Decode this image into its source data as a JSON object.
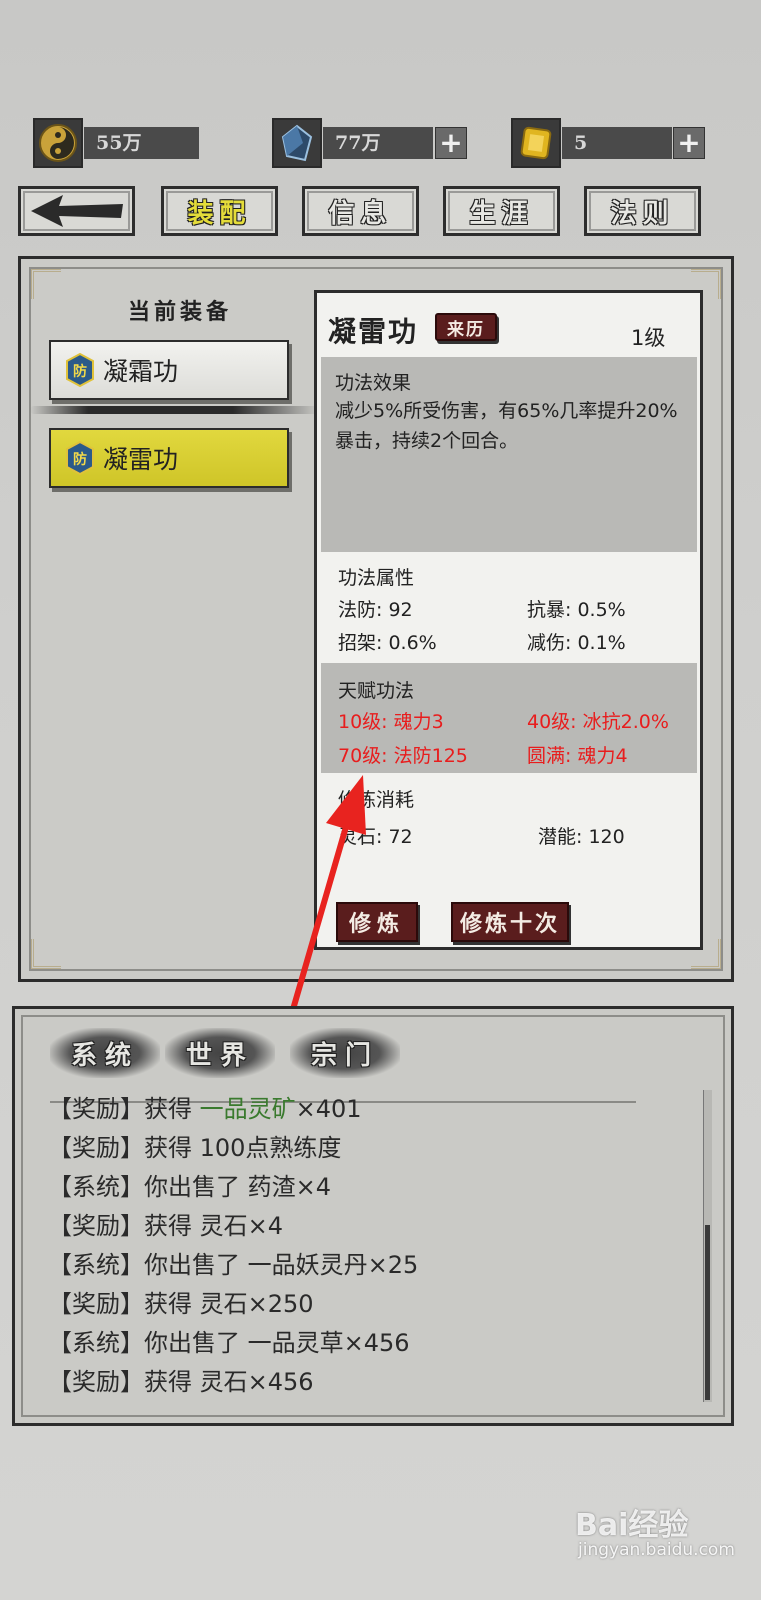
{
  "resources": [
    {
      "icon": "yin-yang-icon",
      "value": "55万",
      "has_plus": false
    },
    {
      "icon": "blue-crystal-icon",
      "value": "77万",
      "has_plus": true
    },
    {
      "icon": "gold-gem-icon",
      "value": "5",
      "has_plus": true
    }
  ],
  "nav": {
    "tabs": [
      "装配",
      "信息",
      "生涯",
      "法则"
    ],
    "active_tab": "装配"
  },
  "equip": {
    "header": "当前装备",
    "items": [
      {
        "label": "凝霜功",
        "badge": "防",
        "selected": false
      },
      {
        "label": "凝雷功",
        "badge": "防",
        "selected": true
      }
    ]
  },
  "detail": {
    "name": "凝雷功",
    "origin_button": "来历",
    "level": "1级",
    "effect_title": "功法效果",
    "effect_text": "减少5%所受伤害，有65%几率提升20%暴击，持续2个回合。",
    "attr_title": "功法属性",
    "attrs": [
      "法防: 92",
      "抗暴: 0.5%",
      "招架: 0.6%",
      "减伤: 0.1%"
    ],
    "talent_title": "天赋功法",
    "talents": [
      "10级: 魂力3",
      "40级: 冰抗2.0%",
      "70级: 法防125",
      "圆满: 魂力4"
    ],
    "cost_title": "修炼消耗",
    "costs": [
      "灵石: 72",
      "潜能: 120"
    ],
    "train_button": "修炼",
    "train10_button": "修炼十次"
  },
  "chat": {
    "tabs": [
      "系统",
      "世界",
      "宗门"
    ],
    "lines": [
      {
        "prefix": "【奖励】",
        "text": "获得 ",
        "item": "一品灵矿",
        "suffix": "×401",
        "item_color": "#3a7a2e"
      },
      {
        "prefix": "【奖励】",
        "text": "获得 100点熟练度",
        "item": "",
        "suffix": ""
      },
      {
        "prefix": "【系统】",
        "text": "你出售了 药渣×4",
        "item": "",
        "suffix": ""
      },
      {
        "prefix": "【奖励】",
        "text": "获得 灵石×4",
        "item": "",
        "suffix": ""
      },
      {
        "prefix": "【系统】",
        "text": "你出售了 一品妖灵丹×25",
        "item": "",
        "suffix": ""
      },
      {
        "prefix": "【奖励】",
        "text": "获得 灵石×250",
        "item": "",
        "suffix": ""
      },
      {
        "prefix": "【系统】",
        "text": "你出售了 一品灵草×456",
        "item": "",
        "suffix": ""
      },
      {
        "prefix": "【奖励】",
        "text": "获得 灵石×456",
        "item": "",
        "suffix": ""
      }
    ]
  },
  "watermark": {
    "logo": "Bai经验",
    "url": "jingyan.baidu.com"
  }
}
